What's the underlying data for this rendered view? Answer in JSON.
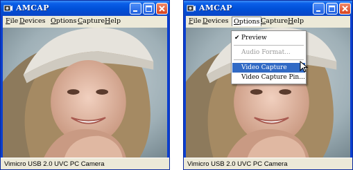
{
  "windows": [
    {
      "title": "AMCAP",
      "menu": [
        {
          "label": "File",
          "key": "F",
          "rest": "ile"
        },
        {
          "label": "Devices",
          "key": "D",
          "rest": "evices"
        },
        {
          "label": "Options",
          "key": "O",
          "rest": "ptions"
        },
        {
          "label": "Capture",
          "key": "C",
          "rest": "apture"
        },
        {
          "label": "Help",
          "key": "H",
          "rest": "elp"
        }
      ],
      "status": "Vimicro USB 2.0 UVC PC Camera"
    },
    {
      "title": "AMCAP",
      "menu": [
        {
          "label": "File",
          "key": "F",
          "rest": "ile"
        },
        {
          "label": "Devices",
          "key": "D",
          "rest": "evices"
        },
        {
          "label": "Options",
          "key": "O",
          "rest": "ptions"
        },
        {
          "label": "Capture",
          "key": "C",
          "rest": "apture"
        },
        {
          "label": "Help",
          "key": "H",
          "rest": "elp"
        }
      ],
      "status": "Vimicro USB 2.0 UVC PC Camera",
      "active_menu": "Options"
    }
  ],
  "options_menu": {
    "items": [
      {
        "label": "Preview",
        "checked": true,
        "enabled": true
      },
      {
        "label": "Audio Format...",
        "enabled": false
      },
      {
        "label": "Video Capture Filter...",
        "enabled": true,
        "highlighted": true
      },
      {
        "label": "Video Capture Pin...",
        "enabled": true
      }
    ]
  },
  "colors": {
    "titlebar": "#0050d8",
    "menu_bg": "#ece9d8",
    "highlight": "#316ac5",
    "close_button": "#d8421e"
  },
  "icons": [
    "amcap-app-icon",
    "minimize-icon",
    "maximize-icon",
    "close-icon",
    "checkmark-icon",
    "mouse-cursor-icon"
  ]
}
